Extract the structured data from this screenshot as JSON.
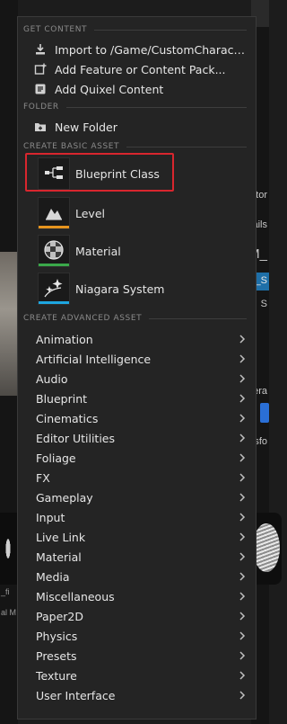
{
  "background": {
    "right_texts": [
      "tor",
      "ails",
      "M_",
      "M_S",
      "S",
      "era",
      "sfo"
    ],
    "left_texts": [
      "_fi",
      "al M"
    ]
  },
  "menu": {
    "get_content": {
      "header": "GET CONTENT",
      "items": [
        {
          "label": "Import to /Game/CustomCharacter...",
          "icon": "import-icon"
        },
        {
          "label": "Add Feature or Content Pack...",
          "icon": "content-pack-icon"
        },
        {
          "label": "Add Quixel Content",
          "icon": "quixel-icon"
        }
      ]
    },
    "folder": {
      "header": "FOLDER",
      "items": [
        {
          "label": "New Folder",
          "icon": "new-folder-icon"
        }
      ]
    },
    "basic": {
      "header": "CREATE BASIC ASSET",
      "items": [
        {
          "label": "Blueprint Class",
          "icon": "blueprint-class-icon",
          "color": "#2a2a2a"
        },
        {
          "label": "Level",
          "icon": "level-icon",
          "color": "#e6941e"
        },
        {
          "label": "Material",
          "icon": "material-icon",
          "color": "#3aa84a"
        },
        {
          "label": "Niagara System",
          "icon": "niagara-icon",
          "color": "#1ea6e0"
        }
      ]
    },
    "advanced": {
      "header": "CREATE ADVANCED ASSET",
      "items": [
        "Animation",
        "Artificial Intelligence",
        "Audio",
        "Blueprint",
        "Cinematics",
        "Editor Utilities",
        "Foliage",
        "FX",
        "Gameplay",
        "Input",
        "Live Link",
        "Material",
        "Media",
        "Miscellaneous",
        "Paper2D",
        "Physics",
        "Presets",
        "Texture",
        "User Interface"
      ]
    }
  }
}
